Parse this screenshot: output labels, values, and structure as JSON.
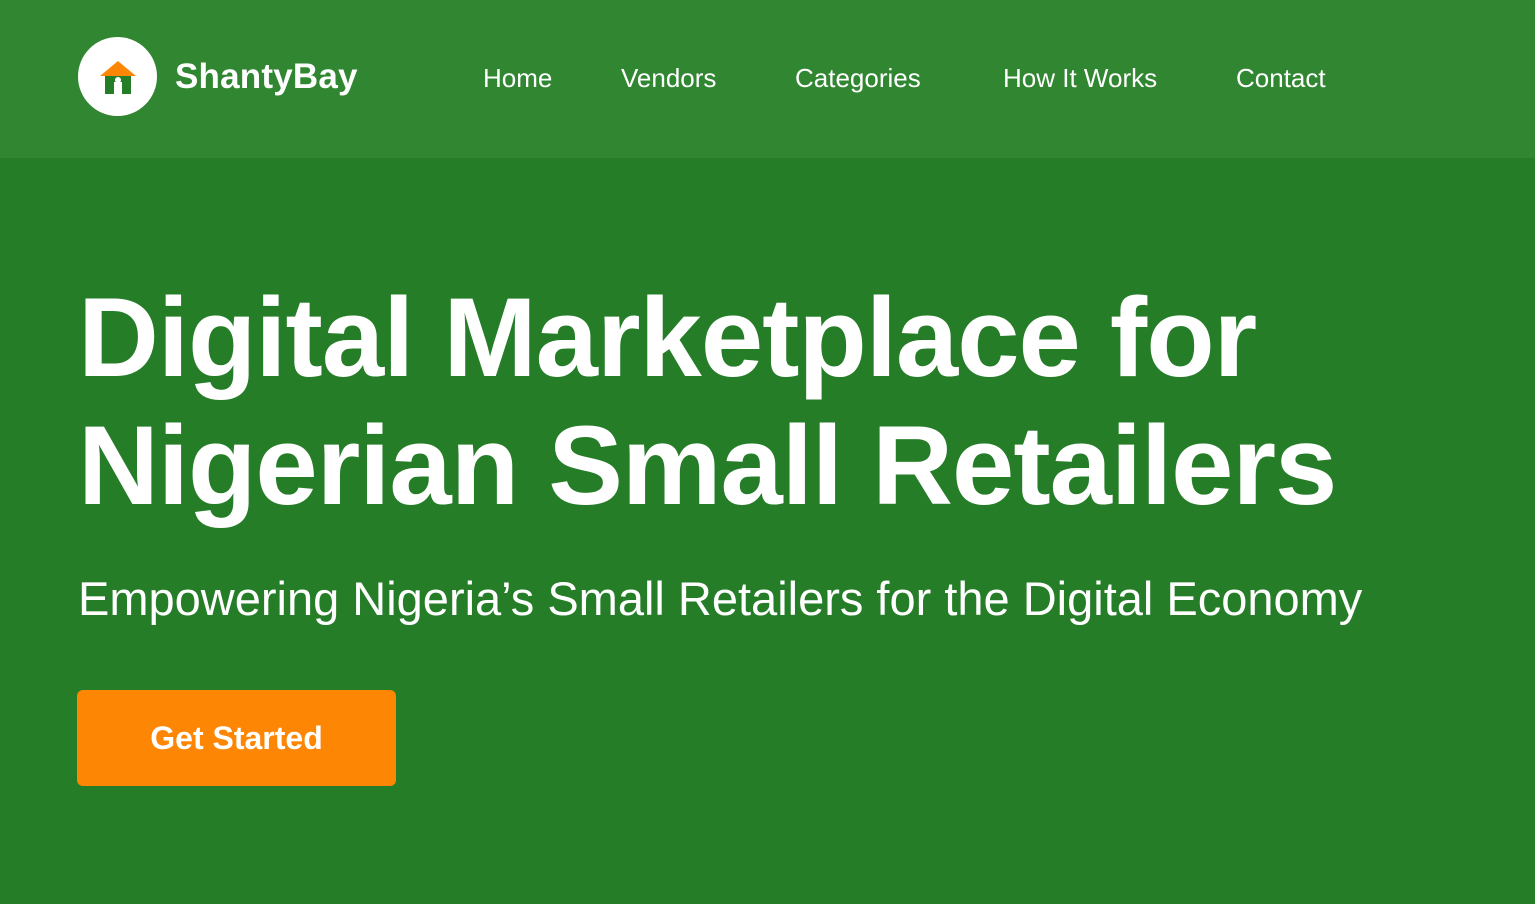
{
  "brand": {
    "name": "ShantyBay",
    "logo_icon": "house-icon",
    "colors": {
      "roof": "#fe8605",
      "house": "#257d27",
      "badge": "#ffffff"
    }
  },
  "nav": {
    "items": [
      {
        "label": "Home"
      },
      {
        "label": "Vendors"
      },
      {
        "label": "Categories"
      },
      {
        "label": "How It Works"
      },
      {
        "label": "Contact"
      }
    ]
  },
  "hero": {
    "title_line1": "Digital Marketplace for",
    "title_line2": "Nigerian Small Retailers",
    "subtitle": "Empowering Nigeria’s Small Retailers for the Digital Economy",
    "cta_label": "Get Started"
  },
  "colors": {
    "header_bg": "#318631",
    "hero_bg": "#257d27",
    "accent": "#fe8605",
    "text": "#ffffff"
  }
}
